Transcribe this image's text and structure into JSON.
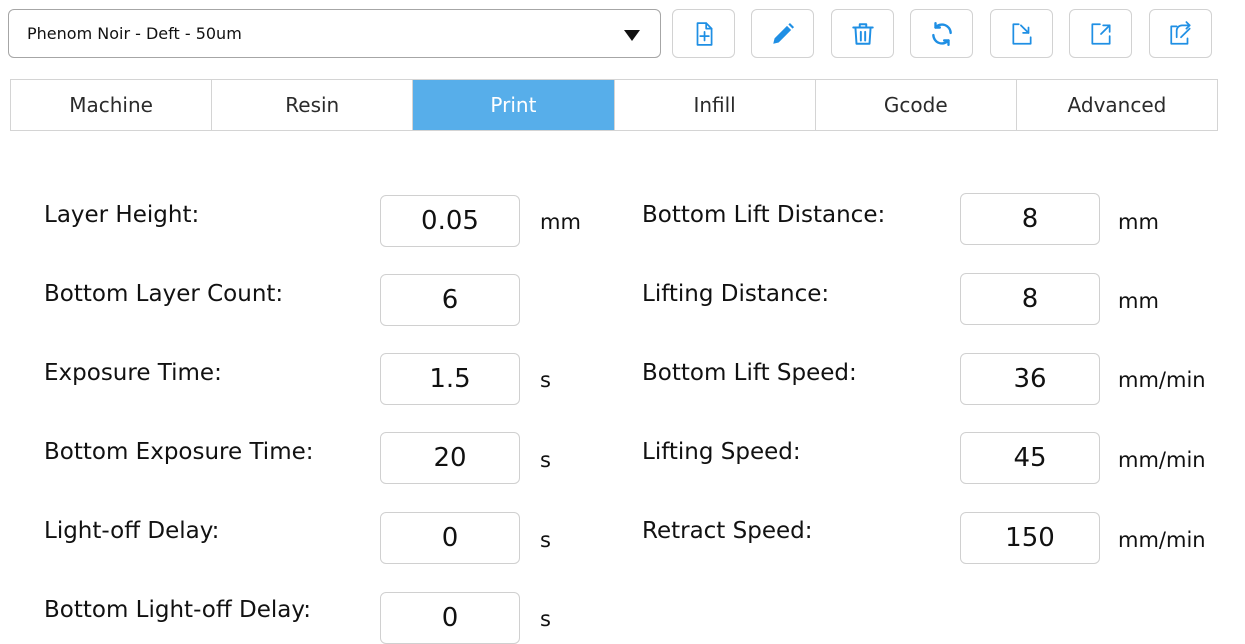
{
  "toolbar": {
    "profile_value": "Phenom Noir - Deft - 50um",
    "buttons": [
      {
        "name": "new-profile",
        "icon": "file-plus-icon"
      },
      {
        "name": "edit-profile",
        "icon": "pencil-icon"
      },
      {
        "name": "delete-profile",
        "icon": "trash-icon"
      },
      {
        "name": "reset-profile",
        "icon": "refresh-icon"
      },
      {
        "name": "import-profile",
        "icon": "import-icon"
      },
      {
        "name": "export-profile",
        "icon": "export-icon"
      },
      {
        "name": "export-all-profiles",
        "icon": "export-multiple-icon"
      }
    ],
    "icon_color": "#1f8fe4"
  },
  "tabs": [
    {
      "label": "Machine"
    },
    {
      "label": "Resin"
    },
    {
      "label": "Print",
      "active": true
    },
    {
      "label": "Infill"
    },
    {
      "label": "Gcode"
    },
    {
      "label": "Advanced"
    }
  ],
  "accent_color": "#57aeea",
  "settings": {
    "left": [
      {
        "label": "Layer Height:",
        "value": "0.05",
        "unit": "mm"
      },
      {
        "label": "Bottom Layer Count:",
        "value": "6",
        "unit": ""
      },
      {
        "label": "Exposure Time:",
        "value": "1.5",
        "unit": "s"
      },
      {
        "label": "Bottom Exposure Time:",
        "value": "20",
        "unit": "s"
      },
      {
        "label": "Light-off Delay:",
        "value": "0",
        "unit": "s"
      },
      {
        "label": "Bottom Light-off Delay:",
        "value": "0",
        "unit": "s"
      }
    ],
    "right": [
      {
        "label": "Bottom Lift Distance:",
        "value": "8",
        "unit": "mm"
      },
      {
        "label": "Lifting Distance:",
        "value": "8",
        "unit": "mm"
      },
      {
        "label": "Bottom Lift Speed:",
        "value": "36",
        "unit": "mm/min"
      },
      {
        "label": "Lifting Speed:",
        "value": "45",
        "unit": "mm/min"
      },
      {
        "label": "Retract Speed:",
        "value": "150",
        "unit": "mm/min"
      }
    ]
  }
}
